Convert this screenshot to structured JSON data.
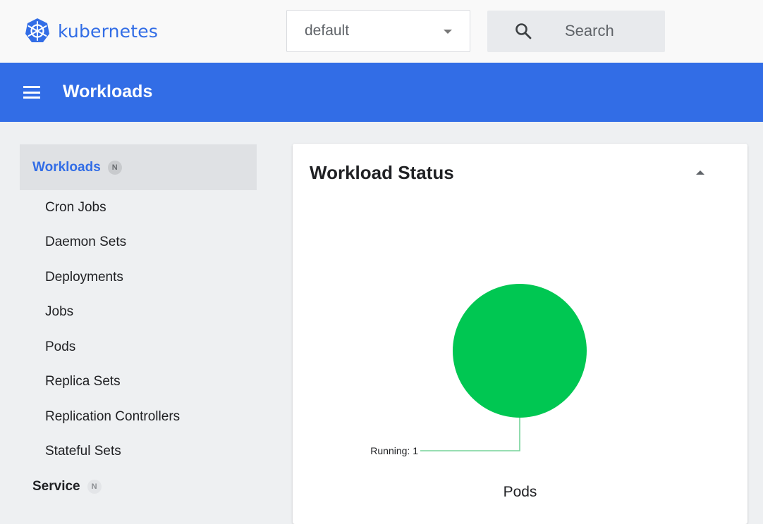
{
  "header": {
    "brand": "kubernetes",
    "namespace": {
      "selected": "default"
    },
    "search": {
      "placeholder": "Search"
    }
  },
  "toolbar": {
    "title": "Workloads"
  },
  "sidebar": {
    "group": {
      "label": "Workloads",
      "badge": "N"
    },
    "items": [
      {
        "label": "Cron Jobs"
      },
      {
        "label": "Daemon Sets"
      },
      {
        "label": "Deployments"
      },
      {
        "label": "Jobs"
      },
      {
        "label": "Pods"
      },
      {
        "label": "Replica Sets"
      },
      {
        "label": "Replication Controllers"
      },
      {
        "label": "Stateful Sets"
      }
    ],
    "next_group": {
      "label": "Service",
      "badge": "N"
    }
  },
  "card": {
    "title": "Workload Status"
  },
  "chart_data": {
    "type": "pie",
    "title": "Pods",
    "slices": [
      {
        "label": "Running",
        "value": 1,
        "color": "#00c752"
      }
    ],
    "label_text": "Running: 1"
  },
  "colors": {
    "brand": "#326de6",
    "running": "#00c752",
    "leader": "#76d49a"
  }
}
